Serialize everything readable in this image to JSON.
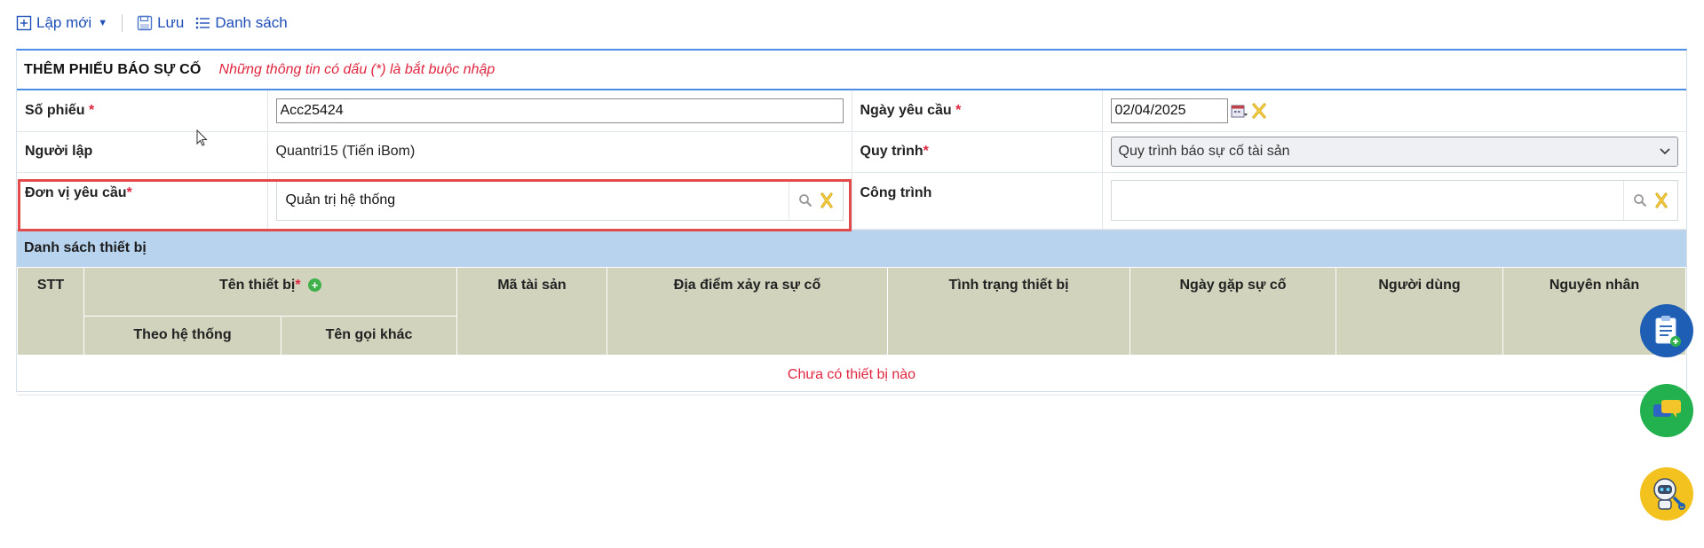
{
  "toolbar": {
    "new_label": "Lập mới",
    "save_label": "Lưu",
    "list_label": "Danh sách"
  },
  "form": {
    "title": "THÊM PHIẾU BÁO SỰ CỐ",
    "note": "Những thông tin có dấu (*) là bắt buộc nhập",
    "required_mark": "*",
    "fields": {
      "so_phieu": {
        "label": "Số phiếu",
        "value": "Acc25424"
      },
      "ngay_yeu_cau": {
        "label": "Ngày yêu cầu",
        "value": "02/04/2025"
      },
      "nguoi_lap": {
        "label": "Người lập",
        "value": "Quantri15 (Tiến iBom)"
      },
      "quy_trinh": {
        "label": "Quy trình",
        "value": "Quy trình báo sự cố tài sản"
      },
      "don_vi_yeu_cau": {
        "label": "Đơn vị yêu cầu",
        "value": "Quản trị hệ thống"
      },
      "cong_trinh": {
        "label": "Công trình",
        "value": ""
      }
    }
  },
  "equipment": {
    "section_title": "Danh sách thiết bị",
    "columns": {
      "stt": "STT",
      "ten_thiet_bi": "Tên thiết bị",
      "theo_he_thong": "Theo hệ thống",
      "ten_goi_khac": "Tên gọi khác",
      "ma_tai_san": "Mã tài sản",
      "dia_diem": "Địa điểm xảy ra sự cố",
      "tinh_trang": "Tình trạng thiết bị",
      "ngay_gap": "Ngày gặp sự cố",
      "nguoi_dung": "Người dùng",
      "nguyen_nhan": "Nguyên nhân"
    },
    "empty_message": "Chưa có thiết bị nào",
    "rows": []
  },
  "colors": {
    "accent_blue": "#4b8de6",
    "required_red": "#e0253f",
    "section_bg": "#b7d3ee",
    "header_bg": "#d1d3bd",
    "highlight": "#e24b4b"
  },
  "icons": {
    "new": "plus-square-icon",
    "save": "floppy-disk-icon",
    "list": "list-icon",
    "calendar": "calendar-icon",
    "clear": "clear-x-icon",
    "search": "search-icon",
    "add": "add-circle-icon",
    "fab1": "clipboard-add-icon",
    "fab2": "chat-icon",
    "fab3": "robot-support-icon"
  }
}
